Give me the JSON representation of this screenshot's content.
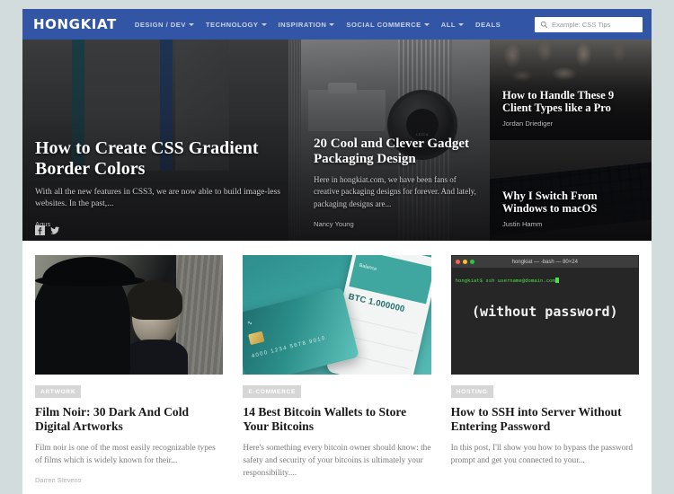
{
  "site": {
    "logo": "HONGKIAT",
    "brand_color": "#3355a5",
    "page_bg": "#d3dcdd"
  },
  "nav": {
    "items": [
      {
        "label": "DESIGN / DEV",
        "has_dropdown": true
      },
      {
        "label": "TECHNOLOGY",
        "has_dropdown": true
      },
      {
        "label": "INSPIRATION",
        "has_dropdown": true
      },
      {
        "label": "SOCIAL COMMERCE",
        "has_dropdown": true
      },
      {
        "label": "ALL",
        "has_dropdown": true
      },
      {
        "label": "DEALS",
        "has_dropdown": false
      }
    ]
  },
  "search": {
    "placeholder": "Example: CSS Tips",
    "value": "",
    "icon": "search-icon"
  },
  "hero": {
    "primary": {
      "title": "How to Create CSS Gradient Border Colors",
      "excerpt": "With all the new features in CSS3, we are now able to build image-less websites. In the past,...",
      "author": "Agus"
    },
    "secondary": {
      "title": "20 Cool and Clever Gadget Packaging Design",
      "excerpt": "Here in hongkiat.com, we have been fans of creative packaging designs for forever. And lately, packaging designs are...",
      "author": "Nancy Young"
    },
    "side": [
      {
        "title": "How to Handle These 9 Client Types like a Pro",
        "author": "Jordan Driediger"
      },
      {
        "title": "Why I Switch From Windows to macOS",
        "author": "Justin Hamm"
      }
    ],
    "social": [
      {
        "name": "facebook-icon",
        "glyph": "f"
      },
      {
        "name": "twitter-icon",
        "glyph": "t"
      }
    ]
  },
  "cards": [
    {
      "tag": "ARTWORK",
      "title": "Film Noir: 30 Dark And Cold Digital Artworks",
      "excerpt": "Film noir is one of the most easily recognizable types of films which is widely known for their...",
      "author": "Darren Stevens",
      "image": "film-noir-artwork-image"
    },
    {
      "tag": "E-COMMERCE",
      "title": "14 Best Bitcoin Wallets to Store Your Bitcoins",
      "excerpt": "Here's something every bitcoin owner should know: the safety and security of your bitcoins is ultimately your responsibility....",
      "author": "",
      "image": "bitcoin-wallet-image",
      "image_text": {
        "balance_label": "Balance",
        "amount": "BTC 1.000000",
        "card_digits": "4000 1234 5678 9010"
      }
    },
    {
      "tag": "HOSTING",
      "title": "How to SSH into Server Without Entering Password",
      "excerpt": "In this post, I'll show you how to bypass the password prompt and get you connected to your...",
      "author": "",
      "image": "terminal-ssh-image",
      "terminal": {
        "window_title": "hongkiat — -bash — 80×24",
        "command": "hongkiat$ ssh username@domain.com",
        "headline": "(without password)"
      }
    }
  ]
}
